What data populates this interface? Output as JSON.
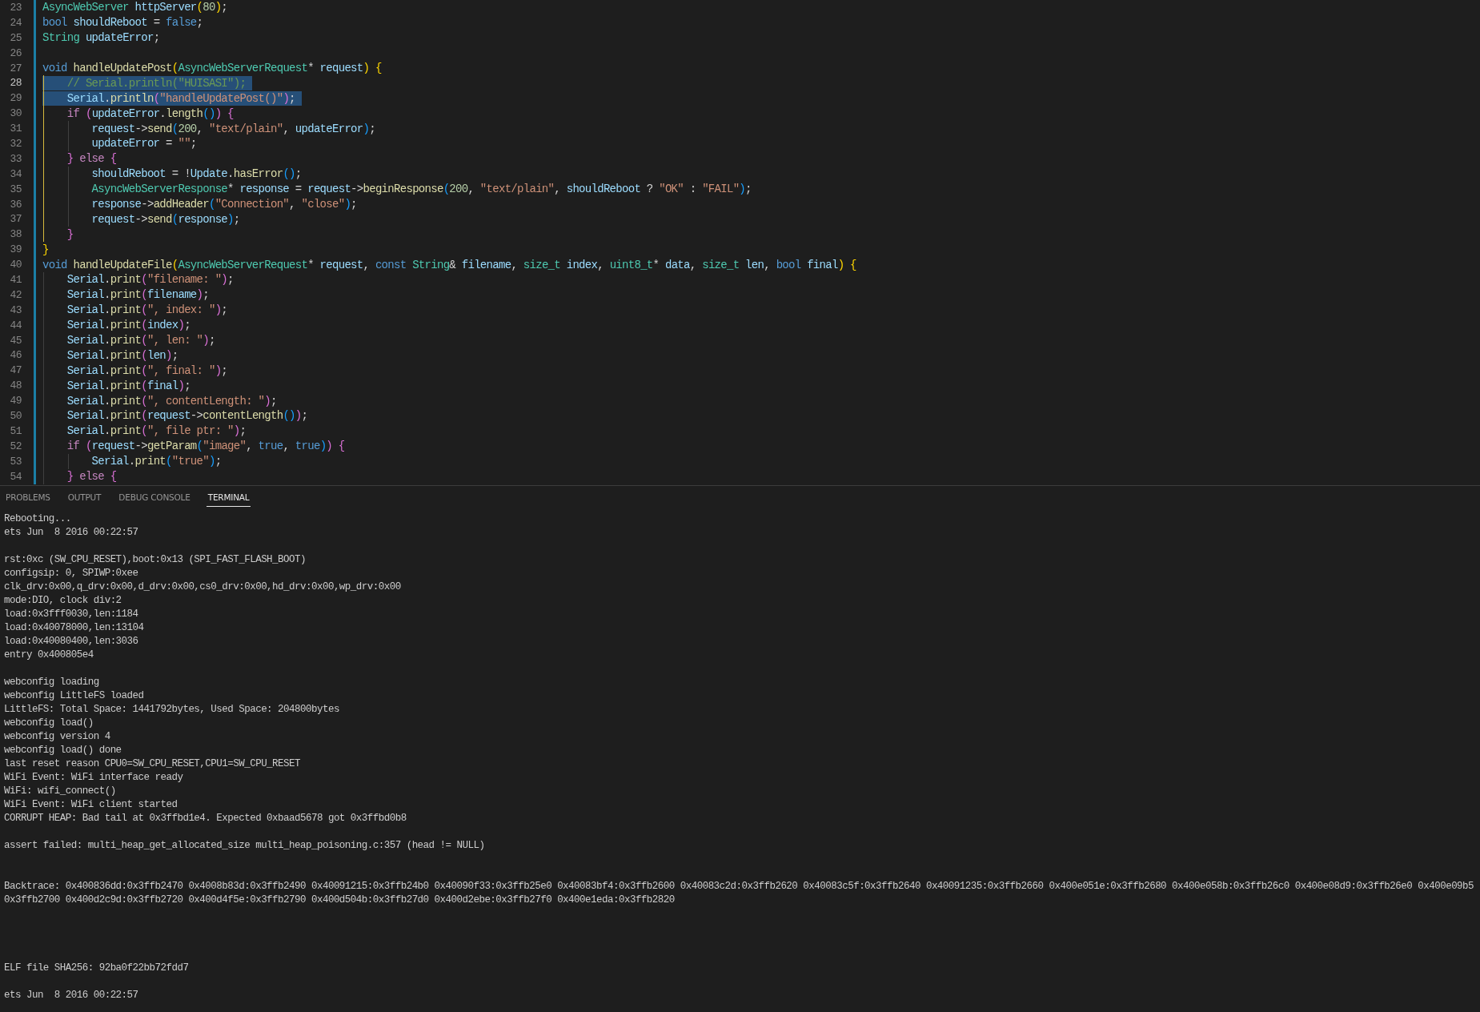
{
  "editor": {
    "lines": [
      {
        "number": "23",
        "selected": false,
        "current": false,
        "guide": false,
        "tokens": [
          {
            "kind": "type",
            "text": "AsyncWebServer"
          },
          {
            "kind": "var",
            "text": " httpServer"
          },
          {
            "kind": "b1",
            "text": "("
          },
          {
            "kind": "num",
            "text": "80"
          },
          {
            "kind": "b1",
            "text": ")"
          },
          {
            "kind": "p",
            "text": ";"
          }
        ]
      },
      {
        "number": "24",
        "selected": false,
        "current": false,
        "guide": false,
        "tokens": [
          {
            "kind": "kw",
            "text": "bool"
          },
          {
            "kind": "var",
            "text": " shouldReboot"
          },
          {
            "kind": "p",
            "text": " = "
          },
          {
            "kind": "kw",
            "text": "false"
          },
          {
            "kind": "p",
            "text": ";"
          }
        ]
      },
      {
        "number": "25",
        "selected": false,
        "current": false,
        "guide": false,
        "tokens": [
          {
            "kind": "type",
            "text": "String"
          },
          {
            "kind": "var",
            "text": " updateError"
          },
          {
            "kind": "p",
            "text": ";"
          }
        ]
      },
      {
        "number": "26",
        "selected": false,
        "current": false,
        "guide": false
      },
      {
        "number": "27",
        "selected": false,
        "current": false,
        "guide": false,
        "tokens": [
          {
            "kind": "kw",
            "text": "void"
          },
          {
            "kind": "fn",
            "text": " handleUpdatePost"
          },
          {
            "kind": "b1",
            "text": "("
          },
          {
            "kind": "type",
            "text": "AsyncWebServerRequest"
          },
          {
            "kind": "p",
            "text": "* "
          },
          {
            "kind": "var",
            "text": "request"
          },
          {
            "kind": "b1",
            "text": ")"
          },
          {
            "kind": "b1",
            "text": " {"
          }
        ]
      },
      {
        "number": "28",
        "selected": true,
        "current": true,
        "guide": true,
        "tokens": [
          {
            "kind": "cmt",
            "text": "    // Serial.println(\"HUISASI\");"
          }
        ]
      },
      {
        "number": "29",
        "selected": true,
        "current": false,
        "guide": true,
        "tokens": [
          {
            "kind": "var",
            "text": "    Serial"
          },
          {
            "kind": "p",
            "text": "."
          },
          {
            "kind": "fn",
            "text": "println"
          },
          {
            "kind": "b2",
            "text": "("
          },
          {
            "kind": "str",
            "text": "\"handleUpdatePost()\""
          },
          {
            "kind": "b2",
            "text": ")"
          },
          {
            "kind": "p",
            "text": ";"
          }
        ]
      },
      {
        "number": "30",
        "selected": false,
        "current": false,
        "guide": true,
        "tokens": [
          {
            "kind": "ctl",
            "text": "    if"
          },
          {
            "kind": "b2",
            "text": " ("
          },
          {
            "kind": "var",
            "text": "updateError"
          },
          {
            "kind": "p",
            "text": "."
          },
          {
            "kind": "fn",
            "text": "length"
          },
          {
            "kind": "b3",
            "text": "()"
          },
          {
            "kind": "b2",
            "text": ")"
          },
          {
            "kind": "b2",
            "text": " {"
          }
        ]
      },
      {
        "number": "31",
        "selected": false,
        "current": false,
        "guide": true,
        "tokens": [
          {
            "kind": "var",
            "text": "        request"
          },
          {
            "kind": "p",
            "text": "->"
          },
          {
            "kind": "fn",
            "text": "send"
          },
          {
            "kind": "b3",
            "text": "("
          },
          {
            "kind": "num",
            "text": "200"
          },
          {
            "kind": "p",
            "text": ", "
          },
          {
            "kind": "str",
            "text": "\"text/plain\""
          },
          {
            "kind": "p",
            "text": ", "
          },
          {
            "kind": "var",
            "text": "updateError"
          },
          {
            "kind": "b3",
            "text": ")"
          },
          {
            "kind": "p",
            "text": ";"
          }
        ]
      },
      {
        "number": "32",
        "selected": false,
        "current": false,
        "guide": true,
        "tokens": [
          {
            "kind": "var",
            "text": "        updateError"
          },
          {
            "kind": "p",
            "text": " = "
          },
          {
            "kind": "str",
            "text": "\"\""
          },
          {
            "kind": "p",
            "text": ";"
          }
        ]
      },
      {
        "number": "33",
        "selected": false,
        "current": false,
        "guide": true,
        "tokens": [
          {
            "kind": "b2",
            "text": "    }"
          },
          {
            "kind": "ctl",
            "text": " else"
          },
          {
            "kind": "b2",
            "text": " {"
          }
        ]
      },
      {
        "number": "34",
        "selected": false,
        "current": false,
        "guide": true,
        "tokens": [
          {
            "kind": "var",
            "text": "        shouldReboot"
          },
          {
            "kind": "p",
            "text": " = !"
          },
          {
            "kind": "var",
            "text": "Update"
          },
          {
            "kind": "p",
            "text": "."
          },
          {
            "kind": "fn",
            "text": "hasError"
          },
          {
            "kind": "b3",
            "text": "()"
          },
          {
            "kind": "p",
            "text": ";"
          }
        ]
      },
      {
        "number": "35",
        "selected": false,
        "current": false,
        "guide": true,
        "tokens": [
          {
            "kind": "type",
            "text": "        AsyncWebServerResponse"
          },
          {
            "kind": "p",
            "text": "* "
          },
          {
            "kind": "var",
            "text": "response"
          },
          {
            "kind": "p",
            "text": " = "
          },
          {
            "kind": "var",
            "text": "request"
          },
          {
            "kind": "p",
            "text": "->"
          },
          {
            "kind": "fn",
            "text": "beginResponse"
          },
          {
            "kind": "b3",
            "text": "("
          },
          {
            "kind": "num",
            "text": "200"
          },
          {
            "kind": "p",
            "text": ", "
          },
          {
            "kind": "str",
            "text": "\"text/plain\""
          },
          {
            "kind": "p",
            "text": ", "
          },
          {
            "kind": "var",
            "text": "shouldReboot"
          },
          {
            "kind": "p",
            "text": " ? "
          },
          {
            "kind": "str",
            "text": "\"OK\""
          },
          {
            "kind": "p",
            "text": " : "
          },
          {
            "kind": "str",
            "text": "\"FAIL\""
          },
          {
            "kind": "b3",
            "text": ")"
          },
          {
            "kind": "p",
            "text": ";"
          }
        ]
      },
      {
        "number": "36",
        "selected": false,
        "current": false,
        "guide": true,
        "tokens": [
          {
            "kind": "var",
            "text": "        response"
          },
          {
            "kind": "p",
            "text": "->"
          },
          {
            "kind": "fn",
            "text": "addHeader"
          },
          {
            "kind": "b3",
            "text": "("
          },
          {
            "kind": "str",
            "text": "\"Connection\""
          },
          {
            "kind": "p",
            "text": ", "
          },
          {
            "kind": "str",
            "text": "\"close\""
          },
          {
            "kind": "b3",
            "text": ")"
          },
          {
            "kind": "p",
            "text": ";"
          }
        ]
      },
      {
        "number": "37",
        "selected": false,
        "current": false,
        "guide": true,
        "tokens": [
          {
            "kind": "var",
            "text": "        request"
          },
          {
            "kind": "p",
            "text": "->"
          },
          {
            "kind": "fn",
            "text": "send"
          },
          {
            "kind": "b3",
            "text": "("
          },
          {
            "kind": "var",
            "text": "response"
          },
          {
            "kind": "b3",
            "text": ")"
          },
          {
            "kind": "p",
            "text": ";"
          }
        ]
      },
      {
        "number": "38",
        "selected": false,
        "current": false,
        "guide": true,
        "tokens": [
          {
            "kind": "b2",
            "text": "    }"
          }
        ]
      },
      {
        "number": "39",
        "selected": false,
        "current": false,
        "guide": false,
        "tokens": [
          {
            "kind": "b1",
            "text": "}"
          }
        ]
      },
      {
        "number": "40",
        "selected": false,
        "current": false,
        "guide": false,
        "tokens": [
          {
            "kind": "kw",
            "text": "void"
          },
          {
            "kind": "fn",
            "text": " handleUpdateFile"
          },
          {
            "kind": "b1",
            "text": "("
          },
          {
            "kind": "type",
            "text": "AsyncWebServerRequest"
          },
          {
            "kind": "p",
            "text": "* "
          },
          {
            "kind": "var",
            "text": "request"
          },
          {
            "kind": "p",
            "text": ", "
          },
          {
            "kind": "kw",
            "text": "const"
          },
          {
            "kind": "type",
            "text": " String"
          },
          {
            "kind": "p",
            "text": "& "
          },
          {
            "kind": "var",
            "text": "filename"
          },
          {
            "kind": "p",
            "text": ", "
          },
          {
            "kind": "type",
            "text": "size_t"
          },
          {
            "kind": "var",
            "text": " index"
          },
          {
            "kind": "p",
            "text": ", "
          },
          {
            "kind": "type",
            "text": "uint8_t"
          },
          {
            "kind": "p",
            "text": "* "
          },
          {
            "kind": "var",
            "text": "data"
          },
          {
            "kind": "p",
            "text": ", "
          },
          {
            "kind": "type",
            "text": "size_t"
          },
          {
            "kind": "var",
            "text": " len"
          },
          {
            "kind": "p",
            "text": ", "
          },
          {
            "kind": "kw",
            "text": "bool"
          },
          {
            "kind": "var",
            "text": " final"
          },
          {
            "kind": "b1",
            "text": ")"
          },
          {
            "kind": "b1",
            "text": " {"
          }
        ]
      },
      {
        "number": "41",
        "selected": false,
        "current": false,
        "guide": false,
        "tokens": [
          {
            "kind": "var",
            "text": "    Serial"
          },
          {
            "kind": "p",
            "text": "."
          },
          {
            "kind": "fn",
            "text": "print"
          },
          {
            "kind": "b2",
            "text": "("
          },
          {
            "kind": "str",
            "text": "\"filename: \""
          },
          {
            "kind": "b2",
            "text": ")"
          },
          {
            "kind": "p",
            "text": ";"
          }
        ]
      },
      {
        "number": "42",
        "selected": false,
        "current": false,
        "guide": false,
        "tokens": [
          {
            "kind": "var",
            "text": "    Serial"
          },
          {
            "kind": "p",
            "text": "."
          },
          {
            "kind": "fn",
            "text": "print"
          },
          {
            "kind": "b2",
            "text": "("
          },
          {
            "kind": "var",
            "text": "filename"
          },
          {
            "kind": "b2",
            "text": ")"
          },
          {
            "kind": "p",
            "text": ";"
          }
        ]
      },
      {
        "number": "43",
        "selected": false,
        "current": false,
        "guide": false,
        "tokens": [
          {
            "kind": "var",
            "text": "    Serial"
          },
          {
            "kind": "p",
            "text": "."
          },
          {
            "kind": "fn",
            "text": "print"
          },
          {
            "kind": "b2",
            "text": "("
          },
          {
            "kind": "str",
            "text": "\", index: \""
          },
          {
            "kind": "b2",
            "text": ")"
          },
          {
            "kind": "p",
            "text": ";"
          }
        ]
      },
      {
        "number": "44",
        "selected": false,
        "current": false,
        "guide": false,
        "tokens": [
          {
            "kind": "var",
            "text": "    Serial"
          },
          {
            "kind": "p",
            "text": "."
          },
          {
            "kind": "fn",
            "text": "print"
          },
          {
            "kind": "b2",
            "text": "("
          },
          {
            "kind": "var",
            "text": "index"
          },
          {
            "kind": "b2",
            "text": ")"
          },
          {
            "kind": "p",
            "text": ";"
          }
        ]
      },
      {
        "number": "45",
        "selected": false,
        "current": false,
        "guide": false,
        "tokens": [
          {
            "kind": "var",
            "text": "    Serial"
          },
          {
            "kind": "p",
            "text": "."
          },
          {
            "kind": "fn",
            "text": "print"
          },
          {
            "kind": "b2",
            "text": "("
          },
          {
            "kind": "str",
            "text": "\", len: \""
          },
          {
            "kind": "b2",
            "text": ")"
          },
          {
            "kind": "p",
            "text": ";"
          }
        ]
      },
      {
        "number": "46",
        "selected": false,
        "current": false,
        "guide": false,
        "tokens": [
          {
            "kind": "var",
            "text": "    Serial"
          },
          {
            "kind": "p",
            "text": "."
          },
          {
            "kind": "fn",
            "text": "print"
          },
          {
            "kind": "b2",
            "text": "("
          },
          {
            "kind": "var",
            "text": "len"
          },
          {
            "kind": "b2",
            "text": ")"
          },
          {
            "kind": "p",
            "text": ";"
          }
        ]
      },
      {
        "number": "47",
        "selected": false,
        "current": false,
        "guide": false,
        "tokens": [
          {
            "kind": "var",
            "text": "    Serial"
          },
          {
            "kind": "p",
            "text": "."
          },
          {
            "kind": "fn",
            "text": "print"
          },
          {
            "kind": "b2",
            "text": "("
          },
          {
            "kind": "str",
            "text": "\", final: \""
          },
          {
            "kind": "b2",
            "text": ")"
          },
          {
            "kind": "p",
            "text": ";"
          }
        ]
      },
      {
        "number": "48",
        "selected": false,
        "current": false,
        "guide": false,
        "tokens": [
          {
            "kind": "var",
            "text": "    Serial"
          },
          {
            "kind": "p",
            "text": "."
          },
          {
            "kind": "fn",
            "text": "print"
          },
          {
            "kind": "b2",
            "text": "("
          },
          {
            "kind": "var",
            "text": "final"
          },
          {
            "kind": "b2",
            "text": ")"
          },
          {
            "kind": "p",
            "text": ";"
          }
        ]
      },
      {
        "number": "49",
        "selected": false,
        "current": false,
        "guide": false,
        "tokens": [
          {
            "kind": "var",
            "text": "    Serial"
          },
          {
            "kind": "p",
            "text": "."
          },
          {
            "kind": "fn",
            "text": "print"
          },
          {
            "kind": "b2",
            "text": "("
          },
          {
            "kind": "str",
            "text": "\", contentLength: \""
          },
          {
            "kind": "b2",
            "text": ")"
          },
          {
            "kind": "p",
            "text": ";"
          }
        ]
      },
      {
        "number": "50",
        "selected": false,
        "current": false,
        "guide": false,
        "tokens": [
          {
            "kind": "var",
            "text": "    Serial"
          },
          {
            "kind": "p",
            "text": "."
          },
          {
            "kind": "fn",
            "text": "print"
          },
          {
            "kind": "b2",
            "text": "("
          },
          {
            "kind": "var",
            "text": "request"
          },
          {
            "kind": "p",
            "text": "->"
          },
          {
            "kind": "fn",
            "text": "contentLength"
          },
          {
            "kind": "b3",
            "text": "()"
          },
          {
            "kind": "b2",
            "text": ")"
          },
          {
            "kind": "p",
            "text": ";"
          }
        ]
      },
      {
        "number": "51",
        "selected": false,
        "current": false,
        "guide": false,
        "tokens": [
          {
            "kind": "var",
            "text": "    Serial"
          },
          {
            "kind": "p",
            "text": "."
          },
          {
            "kind": "fn",
            "text": "print"
          },
          {
            "kind": "b2",
            "text": "("
          },
          {
            "kind": "str",
            "text": "\", file ptr: \""
          },
          {
            "kind": "b2",
            "text": ")"
          },
          {
            "kind": "p",
            "text": ";"
          }
        ]
      },
      {
        "number": "52",
        "selected": false,
        "current": false,
        "guide": false,
        "tokens": [
          {
            "kind": "ctl",
            "text": "    if"
          },
          {
            "kind": "b2",
            "text": " ("
          },
          {
            "kind": "var",
            "text": "request"
          },
          {
            "kind": "p",
            "text": "->"
          },
          {
            "kind": "fn",
            "text": "getParam"
          },
          {
            "kind": "b3",
            "text": "("
          },
          {
            "kind": "str",
            "text": "\"image\""
          },
          {
            "kind": "p",
            "text": ", "
          },
          {
            "kind": "kw",
            "text": "true"
          },
          {
            "kind": "p",
            "text": ", "
          },
          {
            "kind": "kw",
            "text": "true"
          },
          {
            "kind": "b3",
            "text": ")"
          },
          {
            "kind": "b2",
            "text": ")"
          },
          {
            "kind": "b2",
            "text": " {"
          }
        ]
      },
      {
        "number": "53",
        "selected": false,
        "current": false,
        "guide": false,
        "tokens": [
          {
            "kind": "var",
            "text": "        Serial"
          },
          {
            "kind": "p",
            "text": "."
          },
          {
            "kind": "fn",
            "text": "print"
          },
          {
            "kind": "b3",
            "text": "("
          },
          {
            "kind": "str",
            "text": "\"true\""
          },
          {
            "kind": "b3",
            "text": ")"
          },
          {
            "kind": "p",
            "text": ";"
          }
        ]
      },
      {
        "number": "54",
        "selected": false,
        "current": false,
        "guide": false,
        "tokens": [
          {
            "kind": "b2",
            "text": "    }"
          },
          {
            "kind": "ctl",
            "text": " else"
          },
          {
            "kind": "b2",
            "text": " {"
          }
        ]
      }
    ]
  },
  "panel": {
    "tabs": [
      {
        "label": "PROBLEMS",
        "selected": false
      },
      {
        "label": "OUTPUT",
        "selected": false
      },
      {
        "label": "DEBUG CONSOLE",
        "selected": false
      },
      {
        "label": "TERMINAL",
        "selected": true
      }
    ],
    "terminal_lines": [
      {
        "kind": "text",
        "text": "Rebooting..."
      },
      {
        "kind": "text",
        "text": "ets Jun  8 2016 00:22:57"
      },
      {
        "kind": "blank"
      },
      {
        "kind": "text",
        "text": "rst:0xc (SW_CPU_RESET),boot:0x13 (SPI_FAST_FLASH_BOOT)"
      },
      {
        "kind": "text",
        "text": "configsip: 0, SPIWP:0xee"
      },
      {
        "kind": "text",
        "text": "clk_drv:0x00,q_drv:0x00,d_drv:0x00,cs0_drv:0x00,hd_drv:0x00,wp_drv:0x00"
      },
      {
        "kind": "text",
        "text": "mode:DIO, clock div:2"
      },
      {
        "kind": "text",
        "text": "load:0x3fff0030,len:1184"
      },
      {
        "kind": "text",
        "text": "load:0x40078000,len:13104"
      },
      {
        "kind": "text",
        "text": "load:0x40080400,len:3036"
      },
      {
        "kind": "text",
        "text": "entry 0x400805e4"
      },
      {
        "kind": "blank"
      },
      {
        "kind": "text",
        "text": "webconfig loading"
      },
      {
        "kind": "text",
        "text": "webconfig LittleFS loaded"
      },
      {
        "kind": "text",
        "text": "LittleFS: Total Space: 1441792bytes, Used Space: 204800bytes"
      },
      {
        "kind": "text",
        "text": "webconfig load()"
      },
      {
        "kind": "text",
        "text": "webconfig version 4"
      },
      {
        "kind": "text",
        "text": "webconfig load() done"
      },
      {
        "kind": "text",
        "text": "last reset reason CPU0=SW_CPU_RESET,CPU1=SW_CPU_RESET"
      },
      {
        "kind": "text",
        "text": "WiFi Event: WiFi interface ready"
      },
      {
        "kind": "text",
        "text": "WiFi: wifi_connect()"
      },
      {
        "kind": "text",
        "text": "WiFi Event: WiFi client started"
      },
      {
        "kind": "text",
        "text": "CORRUPT HEAP: Bad tail at 0x3ffbd1e4. Expected 0xbaad5678 got 0x3ffbd0b8"
      },
      {
        "kind": "blank"
      },
      {
        "kind": "text",
        "text": "assert failed: multi_heap_get_allocated_size multi_heap_poisoning.c:357 (head != NULL)"
      },
      {
        "kind": "blank"
      },
      {
        "kind": "blank"
      },
      {
        "kind": "text",
        "text": "Backtrace: 0x400836dd:0x3ffb2470 0x4008b83d:0x3ffb2490 0x40091215:0x3ffb24b0 0x40090f33:0x3ffb25e0 0x40083bf4:0x3ffb2600 0x40083c2d:0x3ffb2620 0x40083c5f:0x3ffb2640 0x40091235:0x3ffb2660 0x400e051e:0x3ffb2680 0x400e058b:0x3ffb26c0 0x400e08d9:0x3ffb26e0 0x400e09b5"
      },
      {
        "kind": "text",
        "text": "0x3ffb2700 0x400d2c9d:0x3ffb2720 0x400d4f5e:0x3ffb2790 0x400d504b:0x3ffb27d0 0x400d2ebe:0x3ffb27f0 0x400e1eda:0x3ffb2820"
      },
      {
        "kind": "blank"
      },
      {
        "kind": "blank"
      },
      {
        "kind": "blank"
      },
      {
        "kind": "blank"
      },
      {
        "kind": "text",
        "text": "ELF file SHA256: 92ba0f22bb72fdd7"
      },
      {
        "kind": "blank"
      },
      {
        "kind": "text",
        "text": "ets Jun  8 2016 00:22:57"
      }
    ]
  }
}
